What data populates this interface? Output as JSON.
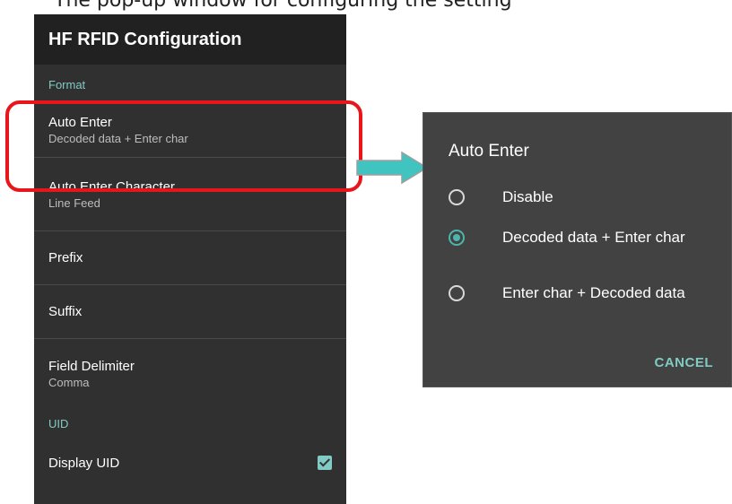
{
  "caption": "The pop-up window for configuring the setting",
  "app_bar": {
    "title": "HF RFID Configuration"
  },
  "sections": {
    "format": "Format",
    "uid": "UID"
  },
  "preferences": {
    "auto_enter": {
      "title": "Auto Enter",
      "summary": "Decoded data + Enter char"
    },
    "auto_enter_char": {
      "title": "Auto Enter Character",
      "summary": "Line Feed"
    },
    "prefix": {
      "title": "Prefix"
    },
    "suffix": {
      "title": "Suffix"
    },
    "field_delimiter": {
      "title": "Field Delimiter",
      "summary": "Comma"
    },
    "display_uid": {
      "title": "Display UID",
      "checked": true
    }
  },
  "dialog": {
    "title": "Auto Enter",
    "options": [
      {
        "label": "Disable",
        "selected": false
      },
      {
        "label": "Decoded data + Enter char",
        "selected": true
      },
      {
        "label": "Enter char + Decoded data",
        "selected": false
      }
    ],
    "cancel_label": "CANCEL"
  },
  "colors": {
    "accent": "#80cbc4",
    "highlight": "#e8151b",
    "arrow": "#40c4c0"
  }
}
